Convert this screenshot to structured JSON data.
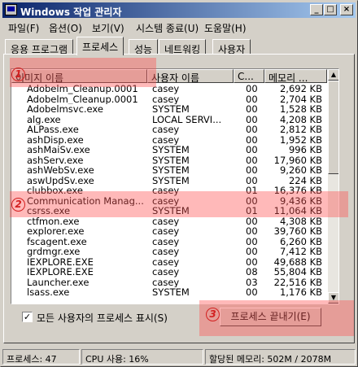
{
  "window": {
    "title": "Windows 작업 관리자",
    "min_label": "_",
    "max_label": "□",
    "close_label": "×"
  },
  "menu": [
    "파일(F)",
    "옵션(O)",
    "보기(V)",
    "시스템 종료(U)",
    "도움말(H)"
  ],
  "tabs": [
    "응용 프로그램",
    "프로세스",
    "성능",
    "네트워킹",
    "사용자"
  ],
  "active_tab": "프로세스",
  "columns": [
    "이미지 이름",
    "사용자 이름",
    "C...",
    "메모리 ..."
  ],
  "processes": [
    {
      "name": "Adobelm_Cleanup.0001",
      "user": "casey",
      "cpu": "00",
      "mem": "2,692 KB"
    },
    {
      "name": "Adobelm_Cleanup.0001",
      "user": "casey",
      "cpu": "00",
      "mem": "2,704 KB"
    },
    {
      "name": "Adobelmsvc.exe",
      "user": "SYSTEM",
      "cpu": "00",
      "mem": "1,528 KB"
    },
    {
      "name": "alg.exe",
      "user": "LOCAL SERVI...",
      "cpu": "00",
      "mem": "4,208 KB"
    },
    {
      "name": "ALPass.exe",
      "user": "casey",
      "cpu": "00",
      "mem": "2,812 KB"
    },
    {
      "name": "ashDisp.exe",
      "user": "casey",
      "cpu": "00",
      "mem": "1,952 KB"
    },
    {
      "name": "ashMaiSv.exe",
      "user": "SYSTEM",
      "cpu": "00",
      "mem": "996 KB"
    },
    {
      "name": "ashServ.exe",
      "user": "SYSTEM",
      "cpu": "00",
      "mem": "17,960 KB"
    },
    {
      "name": "ashWebSv.exe",
      "user": "SYSTEM",
      "cpu": "00",
      "mem": "9,260 KB"
    },
    {
      "name": "aswUpdSv.exe",
      "user": "SYSTEM",
      "cpu": "00",
      "mem": "224 KB"
    },
    {
      "name": "clubbox.exe",
      "user": "casey",
      "cpu": "01",
      "mem": "16,376 KB"
    },
    {
      "name": "Communication Manag...",
      "user": "casey",
      "cpu": "00",
      "mem": "9,436 KB"
    },
    {
      "name": "csrss.exe",
      "user": "SYSTEM",
      "cpu": "01",
      "mem": "11,064 KB"
    },
    {
      "name": "ctfmon.exe",
      "user": "casey",
      "cpu": "00",
      "mem": "4,308 KB"
    },
    {
      "name": "explorer.exe",
      "user": "casey",
      "cpu": "00",
      "mem": "39,760 KB"
    },
    {
      "name": "fscagent.exe",
      "user": "casey",
      "cpu": "00",
      "mem": "6,260 KB"
    },
    {
      "name": "grdmgr.exe",
      "user": "casey",
      "cpu": "00",
      "mem": "7,412 KB"
    },
    {
      "name": "IEXPLORE.EXE",
      "user": "casey",
      "cpu": "00",
      "mem": "49,688 KB"
    },
    {
      "name": "IEXPLORE.EXE",
      "user": "casey",
      "cpu": "08",
      "mem": "55,804 KB"
    },
    {
      "name": "Launcher.exe",
      "user": "casey",
      "cpu": "03",
      "mem": "22,516 KB"
    },
    {
      "name": "lsass.exe",
      "user": "SYSTEM",
      "cpu": "00",
      "mem": "1,176 KB"
    }
  ],
  "show_all_label": "모든 사용자의 프로세스 표시(S)",
  "show_all_checked": "✓",
  "end_process_label": "프로세스 끝내기(E)",
  "scroll": {
    "up": "▲",
    "down": "▼"
  },
  "status": {
    "processes": "프로세스: 47",
    "cpu": "CPU 사용: 16%",
    "memory": "할당된 메모리: 502M / 2078M"
  },
  "annotations": [
    "1",
    "2",
    "3"
  ]
}
